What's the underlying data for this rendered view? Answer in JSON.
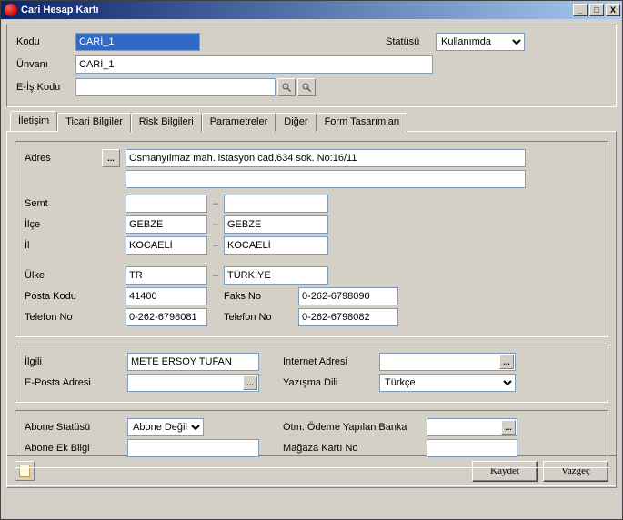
{
  "window": {
    "title": "Cari Hesap Kartı",
    "minimize": "_",
    "maximize": "□",
    "close": "X"
  },
  "header": {
    "kodu_label": "Kodu",
    "kodu_value": "CARİ_1",
    "statusu_label": "Statüsü",
    "statusu_value": "Kullanımda",
    "unvani_label": "Ünvanı",
    "unvani_value": "CARİ_1",
    "eiskodu_label": "E-İş Kodu",
    "eiskodu_value": ""
  },
  "tabs": {
    "iletisim": "İletişim",
    "ticari": "Ticari Bilgiler",
    "risk": "Risk Bilgileri",
    "parametreler": "Parametreler",
    "diger": "Diğer",
    "form": "Form Tasarımları"
  },
  "address": {
    "adres_label": "Adres",
    "adres_value": "Osmanyılmaz mah. istasyon cad.634 sok. No:16/11",
    "adres_line2": "",
    "semt_label": "Semt",
    "semt_code": "",
    "semt_name": "",
    "ilce_label": "İlçe",
    "ilce_code": "GEBZE",
    "ilce_name": "GEBZE",
    "il_label": "İl",
    "il_code": "KOCAELİ",
    "il_name": "KOCAELİ",
    "ulke_label": "Ülke",
    "ulke_code": "TR",
    "ulke_name": "TÜRKİYE",
    "posta_label": "Posta Kodu",
    "posta_value": "41400",
    "faks_label": "Faks No",
    "faks_value": "0-262-6798090",
    "telefon1_label": "Telefon No",
    "telefon1_value": "0-262-6798081",
    "telefon2_label": "Telefon No",
    "telefon2_value": "0-262-6798082"
  },
  "contact": {
    "ilgili_label": "İlgili",
    "ilgili_value": "METE ERSOY TUFAN",
    "eposta_label": "E-Posta Adresi",
    "eposta_value": "",
    "internet_label": "Internet Adresi",
    "internet_value": "",
    "yazisma_label": "Yazışma Dili",
    "yazisma_value": "Türkçe"
  },
  "sub": {
    "abone_label": "Abone Statüsü",
    "abone_value": "Abone Değil",
    "abone_ek_label": "Abone Ek Bilgi",
    "abone_ek_value": "",
    "otm_label": "Otm. Ödeme Yapılan Banka",
    "otm_value": "",
    "magaza_label": "Mağaza Kartı No",
    "magaza_value": ""
  },
  "footer": {
    "kaydet": "Kaydet",
    "vazgec": "Vazgeç"
  },
  "misc": {
    "ellipsis": "...",
    "dash": "–"
  }
}
